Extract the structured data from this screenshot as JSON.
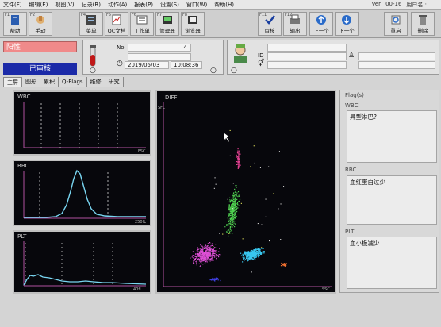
{
  "menu": {
    "items": [
      "文件(F)",
      "编辑(E)",
      "视图(V)",
      "记录(R)",
      "动作(A)",
      "报表(P)",
      "设置(S)",
      "窗口(W)",
      "帮助(H)"
    ],
    "right_text": [
      "Ver",
      "00-16",
      "用户名 :"
    ]
  },
  "toolbar": {
    "buttons": [
      {
        "fkey": "F1",
        "label": "帮助",
        "icon": "help-book-icon"
      },
      {
        "fkey": "F2",
        "label": "手动",
        "icon": "manual-hand-icon"
      },
      {
        "fkey": "F4",
        "label": "菜单",
        "icon": "menu-icon"
      },
      {
        "fkey": "F5",
        "label": "QC文档",
        "icon": "qc-document-icon"
      },
      {
        "fkey": "F6",
        "label": "工作单",
        "icon": "worklist-icon"
      },
      {
        "fkey": "F7",
        "label": "管理器",
        "icon": "manager-icon"
      },
      {
        "fkey": "F8",
        "label": "浏览器",
        "icon": "browser-icon"
      },
      {
        "fkey": "F11",
        "label": "审核",
        "icon": "validate-icon"
      },
      {
        "fkey": "F12",
        "label": "输出",
        "icon": "output-icon"
      },
      {
        "fkey": "",
        "label": "上一个",
        "icon": "arrow-up-icon"
      },
      {
        "fkey": "",
        "label": "下一个",
        "icon": "arrow-down-icon"
      },
      {
        "fkey": "",
        "label": "重启",
        "icon": "restart-icon"
      },
      {
        "fkey": "",
        "label": "删除",
        "icon": "delete-icon"
      }
    ]
  },
  "status": {
    "result_flag": "阳性",
    "review_status": "已审核"
  },
  "sample": {
    "no_label": "No",
    "no_value": "4",
    "date": "2019/05/03",
    "time": "10:08:36"
  },
  "patient": {
    "id_label": "ID"
  },
  "tabs": [
    "主屏",
    "图形",
    "累积",
    "Q-Flags",
    "维修",
    "研究"
  ],
  "plots": {
    "wbc": {
      "title": "WBC",
      "axis_label": "FSC"
    },
    "rbc": {
      "title": "RBC",
      "axis_label": "250fL"
    },
    "plt": {
      "title": "PLT",
      "axis_label": "40fL"
    },
    "diff": {
      "title": "DIFF",
      "x_label": "SSC",
      "y_label": "SFL"
    }
  },
  "flags": {
    "title": "Flag(s)",
    "wbc_label": "WBC",
    "wbc_flag": "异型淋巴?",
    "rbc_label": "RBC",
    "rbc_flag": "血红蛋白过少",
    "plt_label": "PLT",
    "plt_flag": "血小板减少"
  },
  "colors": {
    "result_flag_bg": "#f08a8a",
    "review_bg": "#1b2aa8",
    "histogram_line": "#79d6f2",
    "plot_bg": "#07070c"
  }
}
